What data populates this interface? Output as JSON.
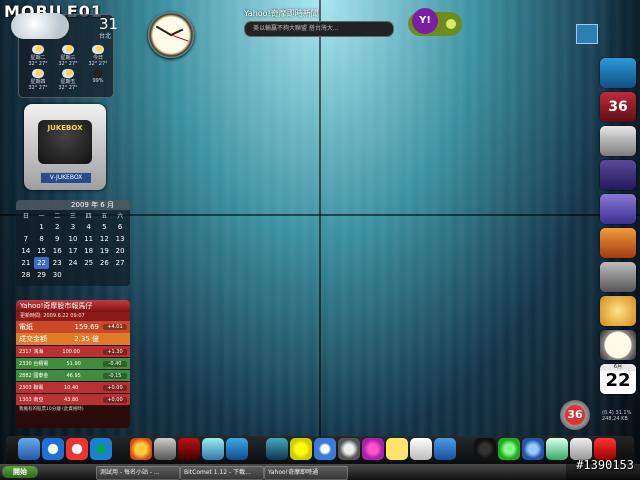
{
  "watermark": "MOBILE01",
  "watermark_id": "#1390153",
  "weather": {
    "current_temp": "31",
    "label": "台北",
    "days": [
      {
        "name": "星期二",
        "temp": "32°  27°"
      },
      {
        "name": "星期三",
        "temp": "32°  27°"
      },
      {
        "name": "今日",
        "temp": "32°  27°"
      },
      {
        "name": "星期四",
        "temp": "32°  27°"
      },
      {
        "name": "星期五",
        "temp": "32°  27°"
      },
      {
        "name": "",
        "temp": "99%"
      }
    ]
  },
  "news": {
    "title": "Yahoo!奇摩即時新聞",
    "headline": "美以輸贏不夠大聯盟 搭台灣大..."
  },
  "jukebox": {
    "logo": "JUKEBOX",
    "label": "V-JUKEBOX"
  },
  "calendar": {
    "header": "2009 年 6 月",
    "weekdays": [
      "日",
      "一",
      "二",
      "三",
      "四",
      "五",
      "六"
    ],
    "weeks": [
      [
        "",
        "1",
        "2",
        "3",
        "4",
        "5",
        "6"
      ],
      [
        "7",
        "8",
        "9",
        "10",
        "11",
        "12",
        "13"
      ],
      [
        "14",
        "15",
        "16",
        "17",
        "18",
        "19",
        "20"
      ],
      [
        "21",
        "22",
        "23",
        "24",
        "25",
        "26",
        "27"
      ],
      [
        "28",
        "29",
        "30",
        "",
        "",
        "",
        ""
      ]
    ],
    "today": "22"
  },
  "stock": {
    "title": "Yahoo!奇摩股市報馬仔",
    "updated": "更新時間: 2009.6.22 09:07",
    "main": [
      {
        "name": "電紙",
        "value": "159.69",
        "change": "+4.01"
      },
      {
        "name": "成交金額",
        "value": "2.35 億",
        "change": ""
      }
    ],
    "rows": [
      {
        "code": "2317",
        "name": "鴻海",
        "price": "100.00",
        "change": "+1.30",
        "dir": "red"
      },
      {
        "code": "2330",
        "name": "台積電",
        "price": "51.90",
        "change": "-0.40",
        "dir": "green"
      },
      {
        "code": "2882",
        "name": "國泰金",
        "price": "46.95",
        "change": "-0.15",
        "dir": "green"
      },
      {
        "code": "2303",
        "name": "聯電",
        "price": "10.40",
        "change": "+0.00",
        "dir": "red"
      },
      {
        "code": "1303",
        "name": "南亞",
        "price": "43.80",
        "change": "+0.00",
        "dir": "red"
      }
    ],
    "footer": "我擁有的股票10分鐘   (此資格時)"
  },
  "right_dock": {
    "badge": "36",
    "cal_month": "6月",
    "cal_day": "22"
  },
  "netinfo": [
    "(0.4) 31.1%",
    "248.24 KB"
  ],
  "taskbar": {
    "start": "開始",
    "tasks": [
      "測試用 - 每名小站 - ...",
      "BitComet 1.12 - 下載...",
      "Yahoo!奇摩即時通"
    ]
  }
}
